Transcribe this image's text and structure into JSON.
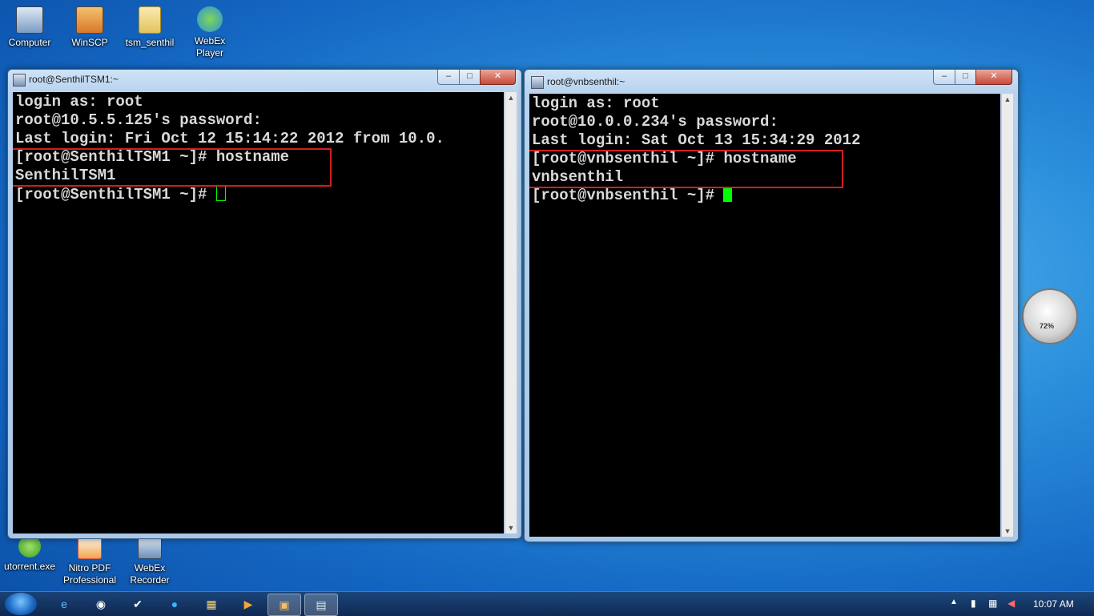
{
  "desktop": {
    "icons_top": [
      {
        "label": "Computer",
        "icon": "computer-icon"
      },
      {
        "label": "WinSCP",
        "icon": "winscp-icon"
      },
      {
        "label": "tsm_senthil",
        "icon": "folder-icon"
      },
      {
        "label": "WebEx Player",
        "icon": "webex-player-icon"
      }
    ],
    "icons_bottom": [
      {
        "label": "utorrent.exe",
        "icon": "utorrent-icon"
      },
      {
        "label": "Nitro PDF Professional",
        "icon": "nitro-pdf-icon"
      },
      {
        "label": "WebEx Recorder",
        "icon": "webex-recorder-icon"
      }
    ]
  },
  "windows": [
    {
      "title": "root@SenthilTSM1:~",
      "lines": [
        "login as: root",
        "root@10.5.5.125's password:",
        "Last login: Fri Oct 12 15:14:22 2012 from 10.0.",
        "[root@SenthilTSM1 ~]# hostname",
        "SenthilTSM1",
        "[root@SenthilTSM1 ~]# "
      ],
      "cursor_style": "hollow"
    },
    {
      "title": "root@vnbsenthil:~",
      "lines": [
        "login as: root",
        "root@10.0.0.234's password:",
        "Last login: Sat Oct 13 15:34:29 2012",
        "[root@vnbsenthil ~]# hostname",
        "vnbsenthil",
        "[root@vnbsenthil ~]# "
      ],
      "cursor_style": "solid"
    }
  ],
  "window_controls": {
    "minimize": "–",
    "maximize": "□",
    "close": "✕"
  },
  "taskbar": {
    "clock": "10:07 AM",
    "pinned": [
      "internet-explorer-icon",
      "hp-icon",
      "mail-icon",
      "skype-icon",
      "explorer-icon",
      "media-player-icon",
      "folder-app-icon",
      "putty-icon"
    ]
  },
  "gadget": {
    "meter_percent": "72%"
  },
  "colors": {
    "highlight": "#d21f1f",
    "cursor": "#00ff00"
  }
}
